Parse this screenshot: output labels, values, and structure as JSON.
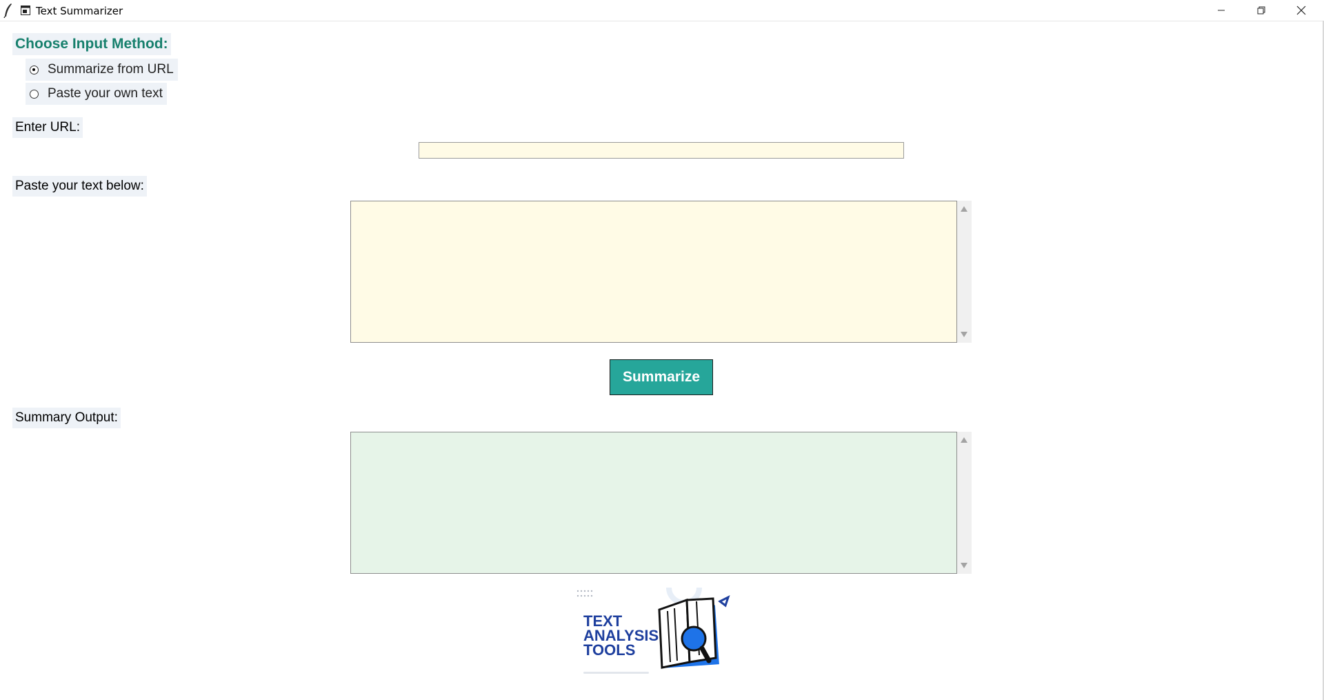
{
  "window": {
    "title": "Text Summarizer",
    "controls": {
      "minimize": "minimize",
      "maximize": "restore",
      "close": "close"
    }
  },
  "input_method": {
    "heading": "Choose Input Method:",
    "options": [
      {
        "label": "Summarize from URL",
        "selected": true
      },
      {
        "label": "Paste your own text",
        "selected": false
      }
    ]
  },
  "url_section": {
    "label": "Enter URL:",
    "value": "",
    "placeholder": ""
  },
  "text_section": {
    "label": "Paste your text below:",
    "value": ""
  },
  "actions": {
    "summarize_label": "Summarize"
  },
  "output_section": {
    "label": "Summary Output:",
    "value": ""
  },
  "logo": {
    "lines": [
      "TEXT",
      "ANALYSIS",
      "TOOLS"
    ]
  },
  "colors": {
    "heading": "#17806d",
    "button_bg": "#26a69a",
    "input_bg": "#fffbe6",
    "output_bg": "#e6f4e8",
    "label_bg": "#eef2f7",
    "logo_blue": "#1e3f9e"
  }
}
